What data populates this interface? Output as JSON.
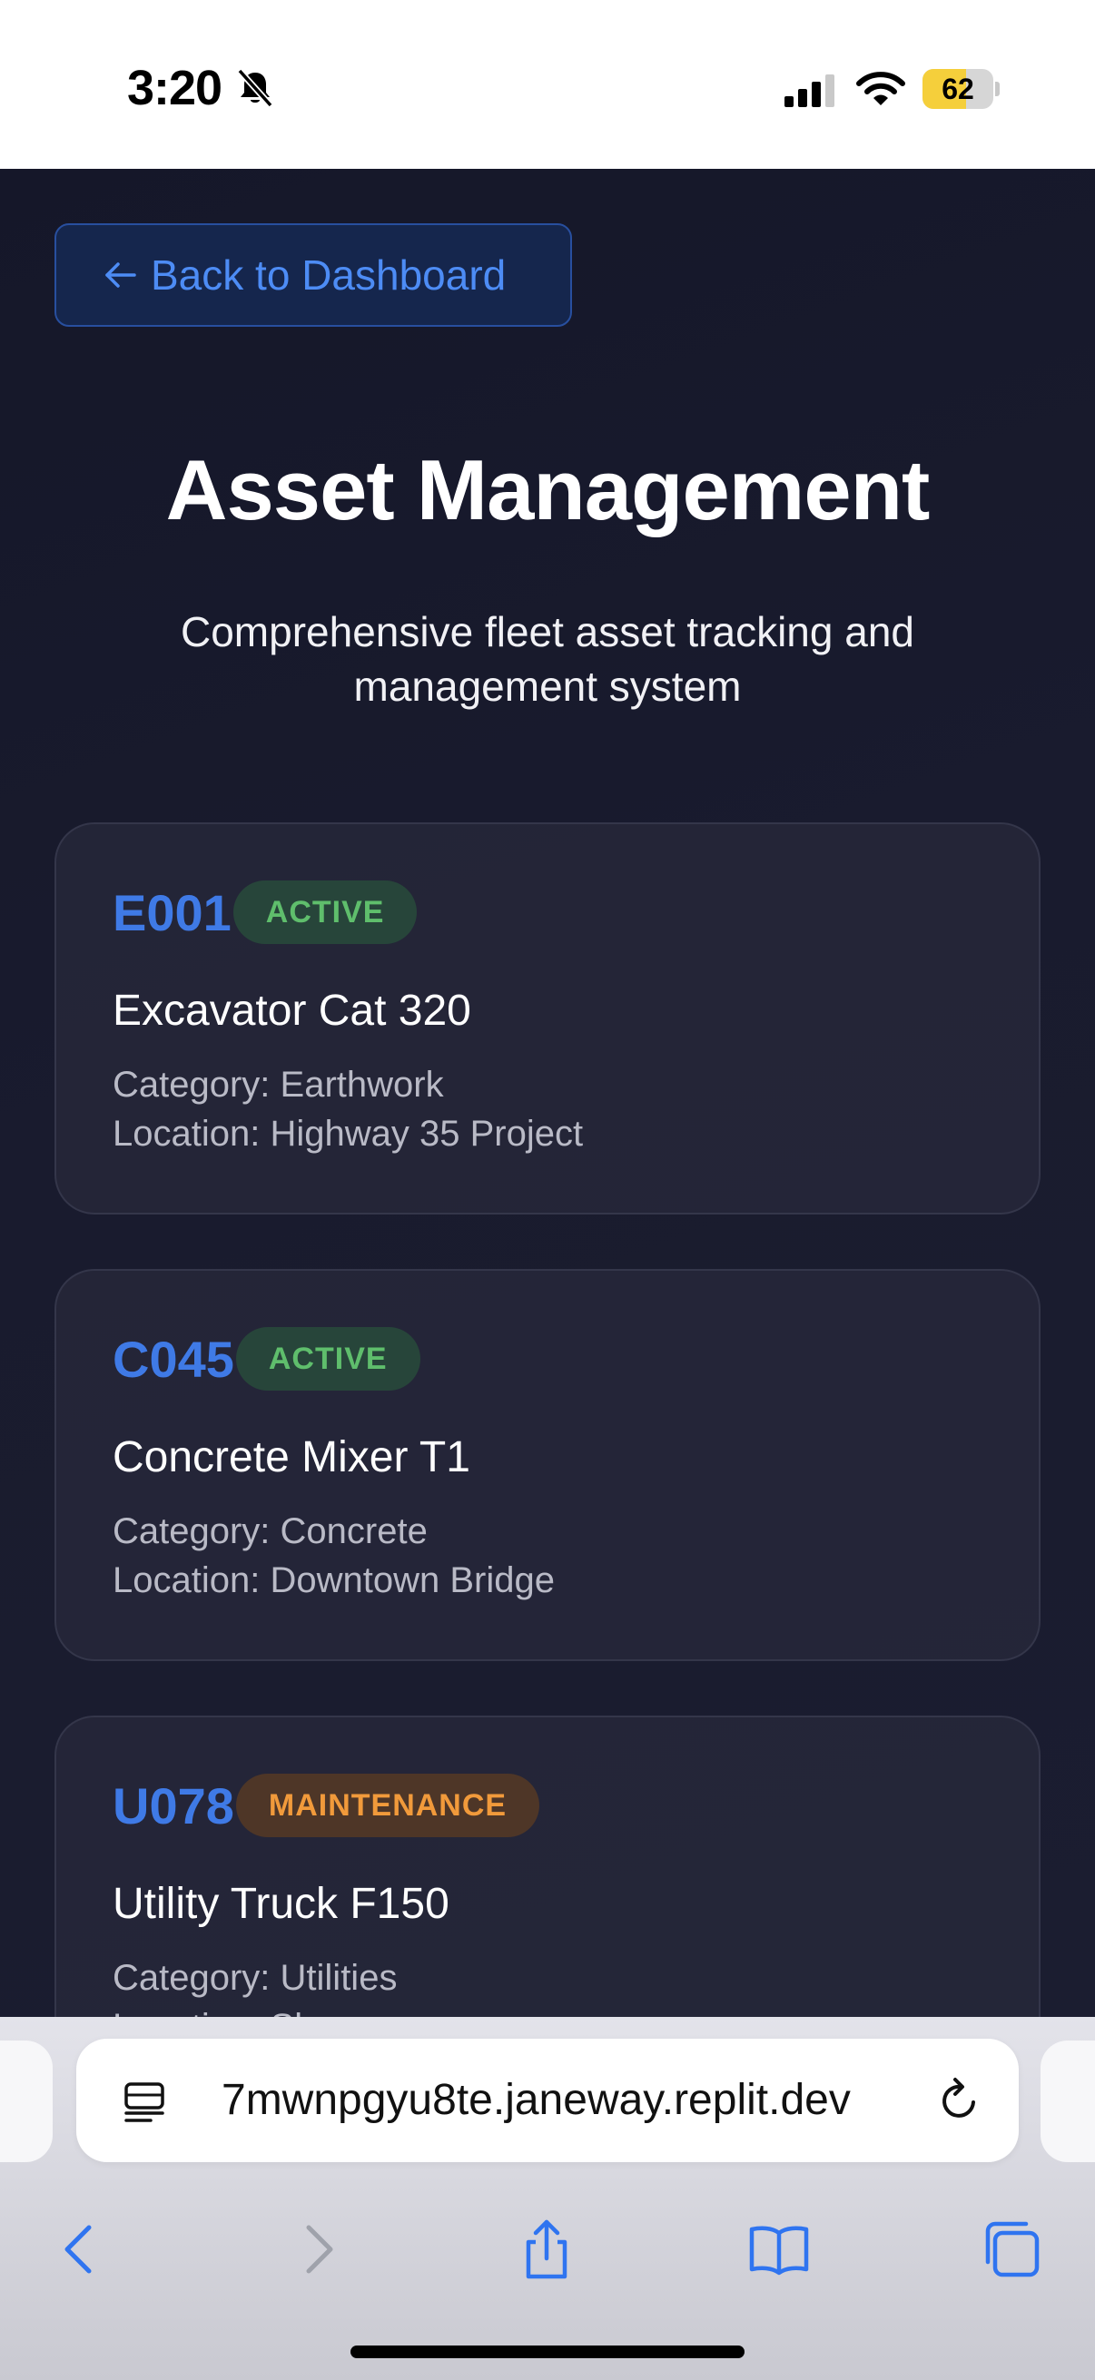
{
  "status_bar": {
    "time": "3:20",
    "battery_level": "62",
    "battery_fraction": 0.62,
    "icons": [
      "bell-slash-icon",
      "cellular-signal-icon",
      "wifi-icon",
      "battery-icon"
    ]
  },
  "page": {
    "back_label": "Back to Dashboard",
    "title": "Asset Management",
    "subtitle": "Comprehensive fleet asset tracking and management system"
  },
  "assets": [
    {
      "id": "E001",
      "status": "ACTIVE",
      "name": "Excavator Cat 320",
      "category": "Category: Earthwork",
      "location": "Location: Highway 35 Project"
    },
    {
      "id": "C045",
      "status": "ACTIVE",
      "name": "Concrete Mixer T1",
      "category": "Category: Concrete",
      "location": "Location: Downtown Bridge"
    },
    {
      "id": "U078",
      "status": "MAINTENANCE",
      "name": "Utility Truck F150",
      "category": "Category: Utilities",
      "location": "Location: Sh"
    }
  ],
  "browser": {
    "url": "7mwnpgyu8te.janeway.replit.dev",
    "toolbar_icons": [
      "back-icon",
      "forward-icon",
      "share-icon",
      "bookmarks-icon",
      "tabs-icon"
    ]
  },
  "colors": {
    "accent": "#3f7ae6",
    "background": "#171a2c",
    "active_badge": "#5fbe6c",
    "maintenance_badge": "#f19a3b",
    "battery": "#f5cf3b"
  }
}
